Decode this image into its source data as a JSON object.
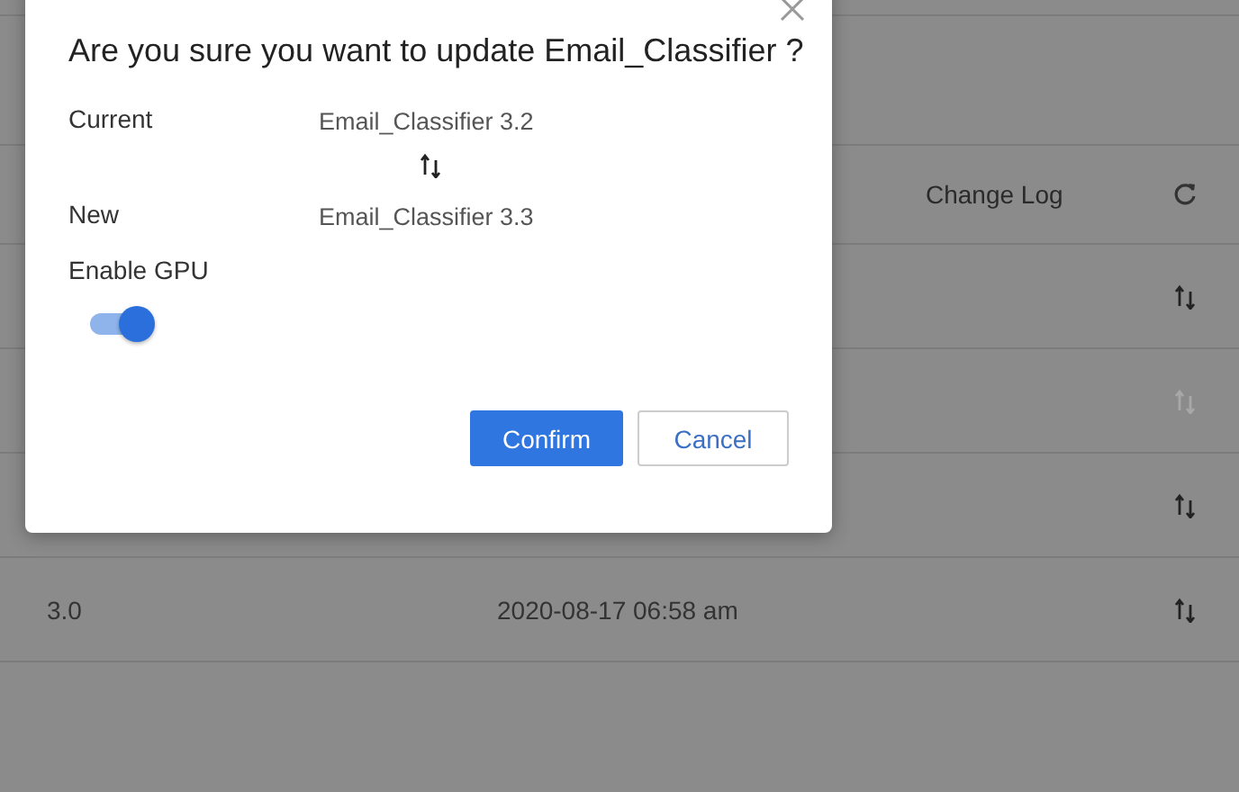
{
  "dialog": {
    "title": "Are you sure you want to update Email_Classifier ?",
    "fields": [
      {
        "label": "Current",
        "value": "Email_Classifier 3.2"
      },
      {
        "label": "New",
        "value": "Email_Classifier 3.3"
      }
    ],
    "gpu_label": "Enable GPU",
    "gpu_toggle": {
      "on": true
    },
    "buttons": [
      {
        "label": "Confirm",
        "kind": "primary"
      },
      {
        "label": "Cancel",
        "kind": "secondary"
      }
    ]
  },
  "table": {
    "header": {
      "column_3": "Change Log"
    },
    "rows": [
      {
        "disabled": false
      },
      {
        "disabled": true
      },
      {
        "disabled": false
      },
      {
        "version": "3.0",
        "date": "2020-08-17 06:58 am",
        "disabled": false
      }
    ]
  }
}
